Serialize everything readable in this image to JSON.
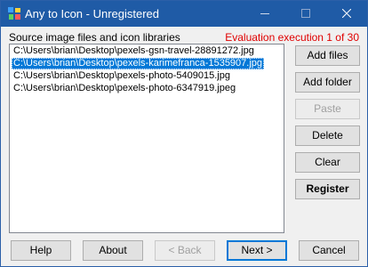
{
  "window": {
    "title": "Any to Icon - Unregistered"
  },
  "labels": {
    "source": "Source image files and icon libraries",
    "evaluation": "Evaluation execution 1 of 30"
  },
  "files": [
    "C:\\Users\\brian\\Desktop\\pexels-gsn-travel-28891272.jpg",
    "C:\\Users\\brian\\Desktop\\pexels-karimefranca-1535907.jpg",
    "C:\\Users\\brian\\Desktop\\pexels-photo-5409015.jpg",
    "C:\\Users\\brian\\Desktop\\pexels-photo-6347919.jpeg"
  ],
  "selected_index": 1,
  "side_buttons": {
    "add_files": "Add files",
    "add_folder": "Add folder",
    "paste": "Paste",
    "delete": "Delete",
    "clear": "Clear",
    "register": "Register"
  },
  "bottom_buttons": {
    "help": "Help",
    "about": "About",
    "back": "< Back",
    "next": "Next >",
    "cancel": "Cancel"
  },
  "colors": {
    "titlebar": "#1f5ba6",
    "selection": "#0078d7",
    "evaluation_text": "#e00000"
  },
  "icons": {
    "app": "app-icon",
    "minimize": "minimize-icon",
    "maximize": "maximize-icon",
    "close": "close-icon"
  }
}
